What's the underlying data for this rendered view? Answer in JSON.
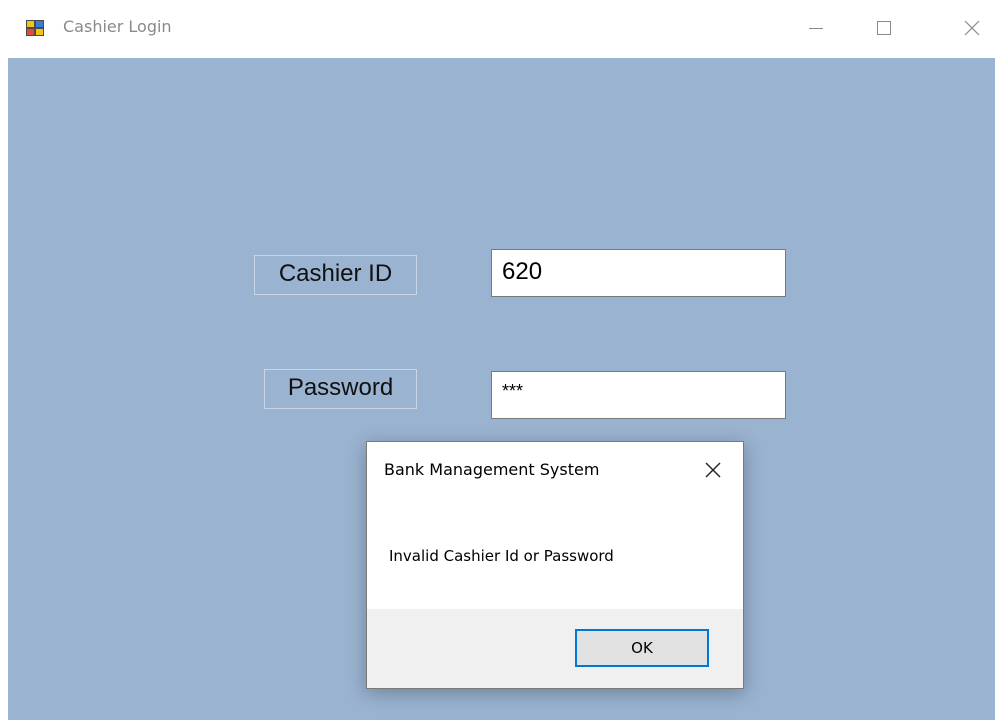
{
  "window": {
    "title": "Cashier Login",
    "icon": "winforms-app-icon",
    "controls": {
      "minimize_icon": "minimize-icon",
      "maximize_icon": "maximize-icon",
      "close_icon": "close-icon"
    },
    "background_color": "#9ab3d1"
  },
  "form": {
    "cashier_id_label": "Cashier ID",
    "cashier_id_value": "620",
    "password_label": "Password",
    "password_value": "***"
  },
  "dialog": {
    "title": "Bank Management System",
    "message": "Invalid Cashier Id or Password",
    "ok_label": "OK",
    "close_icon": "close-icon",
    "accent_color": "#0078d7"
  }
}
